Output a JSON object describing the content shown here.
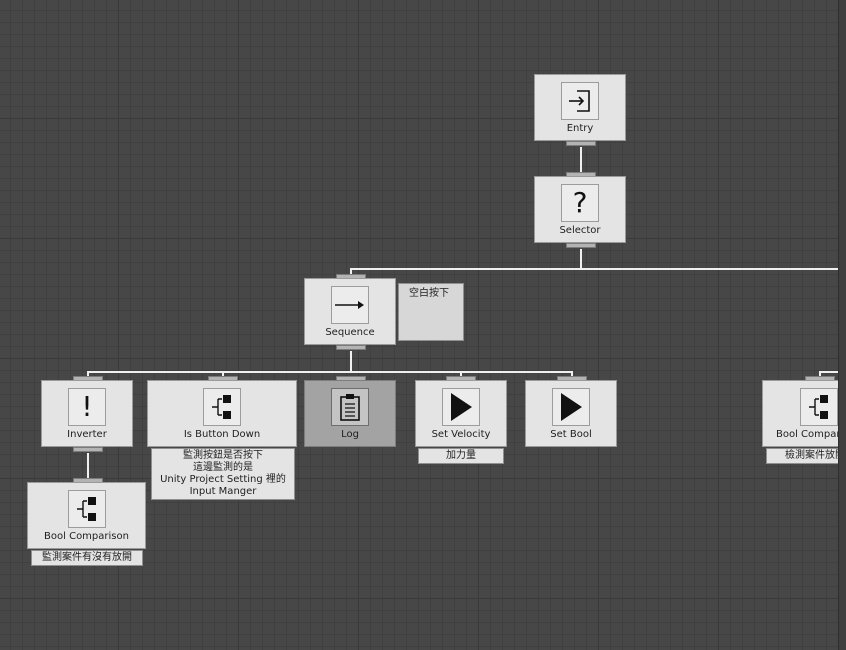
{
  "nodes": {
    "entry": {
      "label": "Entry",
      "icon": "entry-icon"
    },
    "selector": {
      "label": "Selector",
      "icon": "question-mark-icon"
    },
    "sequence": {
      "label": "Sequence",
      "icon": "arrow-right-icon"
    },
    "inverter": {
      "label": "Inverter",
      "icon": "exclamation-icon"
    },
    "is_button_down": {
      "label": "Is Button Down",
      "icon": "conditional-icon"
    },
    "log": {
      "label": "Log",
      "icon": "notepad-icon"
    },
    "set_velocity": {
      "label": "Set Velocity",
      "icon": "play-icon"
    },
    "set_bool": {
      "label": "Set Bool",
      "icon": "play-icon"
    },
    "bool_comparison_left": {
      "label": "Bool Comparison",
      "icon": "conditional-icon"
    },
    "bool_comparison_right": {
      "label": "Bool Compar",
      "icon": "conditional-icon"
    }
  },
  "comments": {
    "sequence_note": "空白按下",
    "is_button_down_note": {
      "line1": "監測按鈕是否按下",
      "line2": "這邊監測的是",
      "line3": "Unity Project Setting 裡的",
      "line4": "Input Manger"
    },
    "set_velocity_note": "加力量",
    "bool_comparison_left_note": "監測案件有沒有放開",
    "bool_comparison_right_note": "檢測案件放開"
  },
  "colors": {
    "canvas": "#474747",
    "node": "#e4e4e4",
    "node_disabled": "#a3a3a3",
    "connection": "#f0f0f0"
  }
}
